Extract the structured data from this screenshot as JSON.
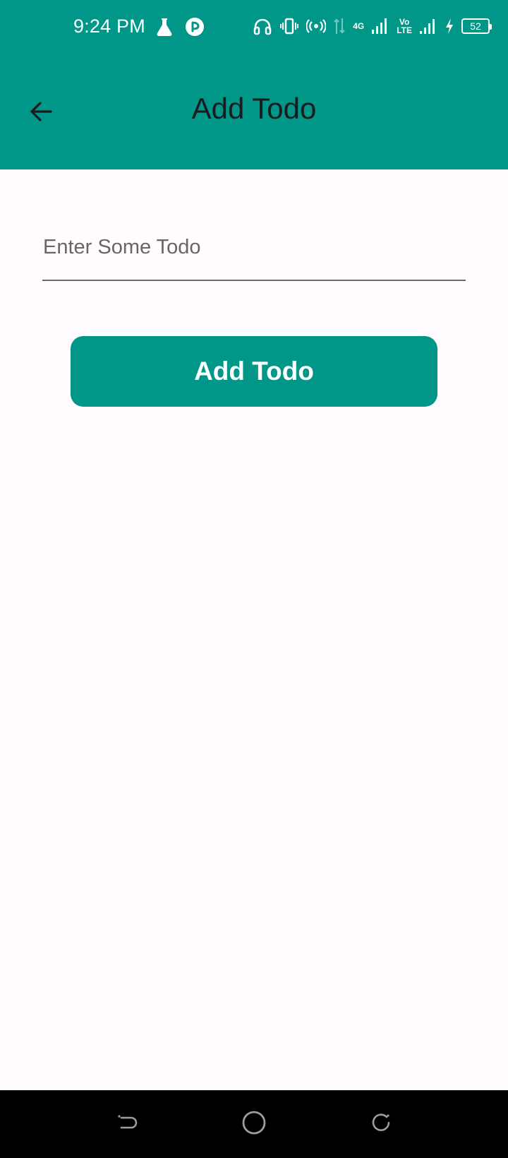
{
  "status_bar": {
    "time": "9:24 PM",
    "network_4g": "4G",
    "volte_top": "Vo",
    "volte_bottom": "LTE",
    "battery_level": "52",
    "icons": [
      "flask-icon",
      "shazam-icon",
      "headphones-icon",
      "vibrate-icon",
      "hotspot-icon",
      "data-arrows-icon",
      "signal-icon",
      "signal-icon",
      "charging-icon",
      "battery-icon"
    ]
  },
  "app_bar": {
    "title": "Add Todo",
    "back_icon": "arrow-left-icon"
  },
  "form": {
    "input_value": "",
    "input_placeholder": "Enter Some Todo",
    "submit_label": "Add Todo"
  },
  "nav_bar": {
    "icons": [
      "back-nav-icon",
      "home-nav-icon",
      "recents-nav-icon"
    ]
  },
  "colors": {
    "primary": "#009688",
    "background": "#fffbfe",
    "title_text": "#1c1b1f",
    "on_primary": "#ffffff"
  }
}
